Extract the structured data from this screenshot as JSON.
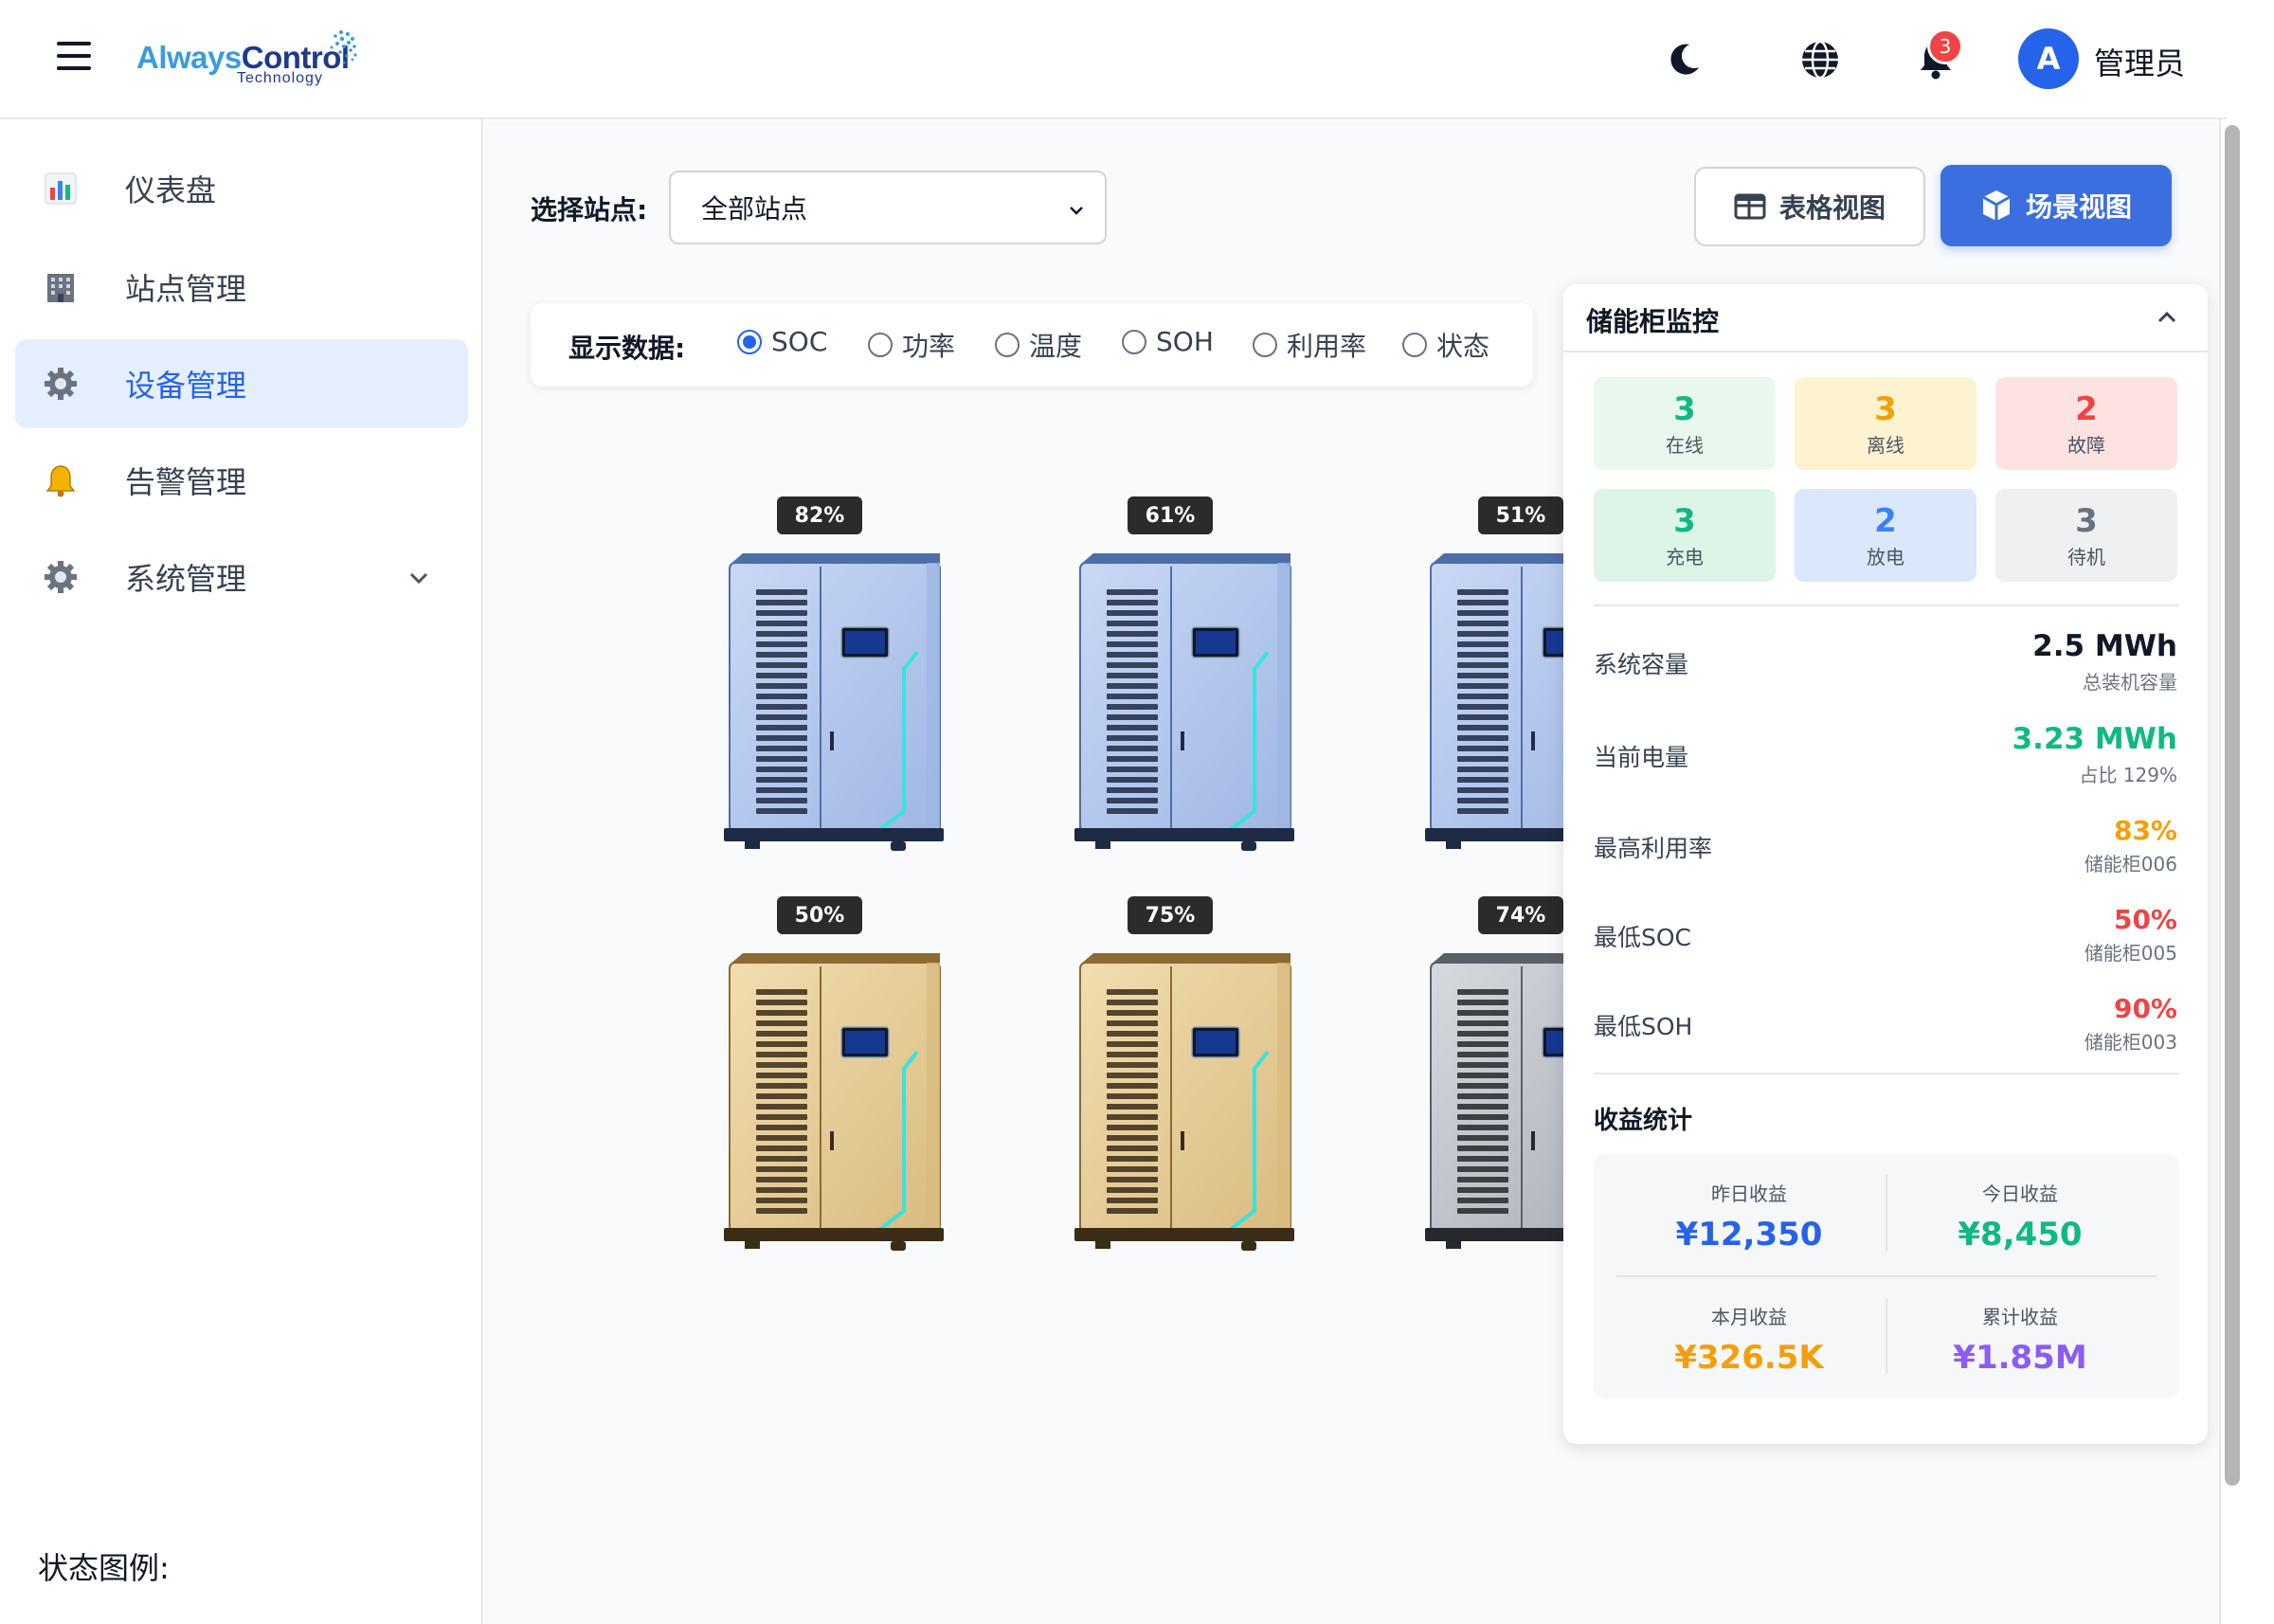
{
  "header": {
    "logo_always": "Always",
    "logo_control": "Control",
    "logo_sub": "Technology",
    "notif_count": "3",
    "avatar_letter": "A",
    "username": "管理员"
  },
  "sidebar": {
    "items": [
      {
        "label": "仪表盘",
        "icon": "bar-chart-icon"
      },
      {
        "label": "站点管理",
        "icon": "building-icon"
      },
      {
        "label": "设备管理",
        "icon": "gear-icon"
      },
      {
        "label": "告警管理",
        "icon": "bell-icon"
      },
      {
        "label": "系统管理",
        "icon": "gear-icon"
      }
    ],
    "legend_label": "状态图例:"
  },
  "toolbar": {
    "station_label": "选择站点:",
    "station_value": "全部站点",
    "table_view": "表格视图",
    "scene_view": "场景视图"
  },
  "display": {
    "label": "显示数据:",
    "options": [
      "SOC",
      "功率",
      "温度",
      "SOH",
      "利用率",
      "状态"
    ],
    "selected": "SOC"
  },
  "cabinets": [
    {
      "soc": "82%",
      "color": "blue"
    },
    {
      "soc": "61%",
      "color": "blue"
    },
    {
      "soc": "51%",
      "color": "blue"
    },
    {
      "soc": "50%",
      "color": "gold"
    },
    {
      "soc": "75%",
      "color": "gold"
    },
    {
      "soc": "74%",
      "color": "gray"
    }
  ],
  "monitor": {
    "title": "储能柜监控",
    "stats": [
      {
        "num": "3",
        "cap": "在线",
        "color": "#10b981",
        "bg": "#e8f8ef"
      },
      {
        "num": "3",
        "cap": "离线",
        "color": "#f59e0b",
        "bg": "#fdf3d0"
      },
      {
        "num": "2",
        "cap": "故障",
        "color": "#ef4444",
        "bg": "#fde2e2"
      },
      {
        "num": "3",
        "cap": "充电",
        "color": "#10b981",
        "bg": "#dcf5e6"
      },
      {
        "num": "2",
        "cap": "放电",
        "color": "#3b82f6",
        "bg": "#dbe7fb"
      },
      {
        "num": "3",
        "cap": "待机",
        "color": "#6b7280",
        "bg": "#eff0f2"
      }
    ],
    "metrics": [
      {
        "label": "系统容量",
        "value": "2.5 MWh",
        "sub": "总装机容量",
        "color": "#111827"
      },
      {
        "label": "当前电量",
        "value": "3.23 MWh",
        "sub": "占比 129%",
        "color": "#10b981"
      },
      {
        "label": "最高利用率",
        "value": "83%",
        "sub": "储能柜006",
        "color": "#f59e0b"
      },
      {
        "label": "最低SOC",
        "value": "50%",
        "sub": "储能柜005",
        "color": "#ef4444"
      },
      {
        "label": "最低SOH",
        "value": "90%",
        "sub": "储能柜003",
        "color": "#ef4444"
      }
    ],
    "revenue_title": "收益统计",
    "revenue": [
      {
        "cap": "昨日收益",
        "val": "¥12,350",
        "color": "#2563eb"
      },
      {
        "cap": "今日收益",
        "val": "¥8,450",
        "color": "#10b981"
      },
      {
        "cap": "本月收益",
        "val": "¥326.5K",
        "color": "#f59e0b"
      },
      {
        "cap": "累计收益",
        "val": "¥1.85M",
        "color": "#8b5cf6"
      }
    ]
  },
  "colors": {
    "accent": "#2563eb"
  }
}
